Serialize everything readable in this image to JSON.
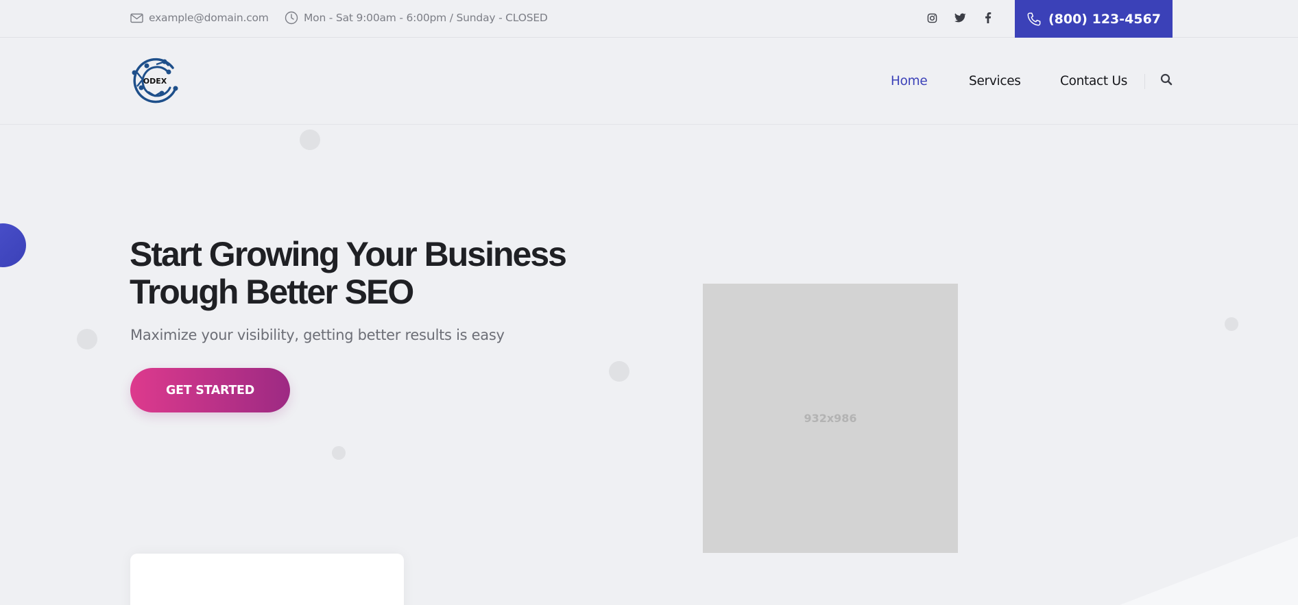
{
  "topbar": {
    "email": "example@domain.com",
    "hours": "Mon - Sat 9:00am - 6:00pm / Sunday - CLOSED",
    "social_icons": [
      "instagram-icon",
      "twitter-icon",
      "facebook-icon"
    ],
    "phone": "(800) 123-4567"
  },
  "header": {
    "logo_text": "ODEX",
    "nav": [
      {
        "label": "Home",
        "active": true
      },
      {
        "label": "Services",
        "active": false
      },
      {
        "label": "Contact Us",
        "active": false
      }
    ],
    "search_icon": "search-icon"
  },
  "hero": {
    "title_line1": "Start Growing Your Business",
    "title_line2": "Trough Better SEO",
    "subtitle": "Maximize your visibility, getting better results is easy",
    "cta_label": "GET STARTED",
    "image_placeholder": "932x986"
  },
  "colors": {
    "primary": "#3b41b8",
    "cta_gradient_start": "#dd3a8d",
    "cta_gradient_end": "#9d2a83",
    "background": "#eff0f3"
  }
}
